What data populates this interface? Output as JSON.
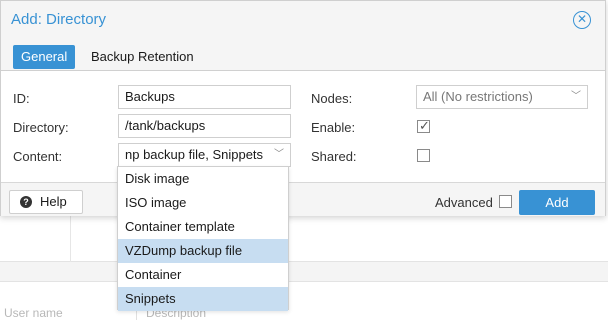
{
  "background": {
    "col_user": "User name",
    "col_description": "Description"
  },
  "dialog": {
    "title": "Add: Directory",
    "close_icon": "close-circle-icon",
    "tabs": [
      {
        "label": "General",
        "active": true
      },
      {
        "label": "Backup Retention",
        "active": false
      }
    ],
    "fields": {
      "id": {
        "label": "ID:",
        "value": "Backups"
      },
      "directory": {
        "label": "Directory:",
        "value": "/tank/backups"
      },
      "content": {
        "label": "Content:",
        "value": "np backup file, Snippets"
      },
      "nodes": {
        "label": "Nodes:",
        "value": "All (No restrictions)"
      },
      "enable": {
        "label": "Enable:",
        "checked": true
      },
      "shared": {
        "label": "Shared:",
        "checked": false
      }
    },
    "footer": {
      "help_label": "Help",
      "help_icon": "question-circle-icon",
      "advanced_label": "Advanced",
      "advanced_checked": false,
      "add_label": "Add"
    }
  },
  "content_dropdown": {
    "options": [
      {
        "label": "Disk image",
        "selected": false
      },
      {
        "label": "ISO image",
        "selected": false
      },
      {
        "label": "Container template",
        "selected": false
      },
      {
        "label": "VZDump backup file",
        "selected": true
      },
      {
        "label": "Container",
        "selected": false
      },
      {
        "label": "Snippets",
        "selected": true
      }
    ]
  },
  "colors": {
    "accent": "#3892d4",
    "selected_item": "#c7ddf1"
  }
}
